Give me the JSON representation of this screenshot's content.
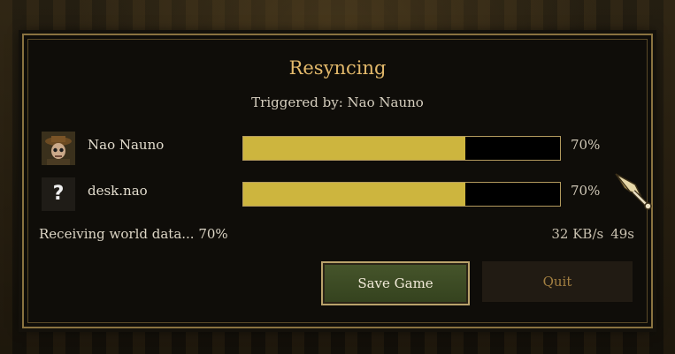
{
  "dialog": {
    "title": "Resyncing",
    "trigger_text": "Triggered by: Nao Nauno"
  },
  "players": [
    {
      "name": "Nao Nauno",
      "avatar_icon": "player-portrait-icon",
      "progress_label": "70%",
      "progress": 0.7
    },
    {
      "name": "desk.nao",
      "avatar_icon": "unknown-question-icon",
      "avatar_glyph": "?",
      "progress_label": "70%",
      "progress": 0.7
    }
  ],
  "status": {
    "text": "Receiving world data... 70%",
    "rate": "32 KB/s",
    "eta": "49s"
  },
  "buttons": {
    "save": "Save Game",
    "quit": "Quit"
  },
  "colors": {
    "title": "#e3b96b",
    "bar_fill": "#cdb53e",
    "save_button": "#3f4e25",
    "border": "#8a7340"
  }
}
